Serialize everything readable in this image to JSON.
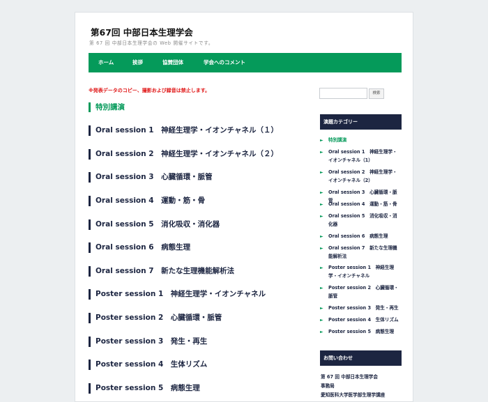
{
  "site": {
    "title": "第67回 中部日本生理学会",
    "description": "第 67 回 中部日本生理学会の Web 開催サイトです。"
  },
  "nav": [
    {
      "label": "ホーム"
    },
    {
      "label": "挨拶"
    },
    {
      "label": "協賛団体"
    },
    {
      "label": "学会へのコメント"
    }
  ],
  "main": {
    "warning": "※発表データのコピー、撮影および録音は禁止します。",
    "section_title": "特別講演",
    "sessions": [
      "Oral session 1　神経生理学・イオンチャネル（１）",
      "Oral session 2　神経生理学・イオンチャネル（２）",
      "Oral session 3　心臓循環・脈管",
      "Oral session 4　運動・筋・骨",
      "Oral session 5　消化吸収・消化器",
      "Oral session 6　病態生理",
      "Oral session 7　新たな生理機能解析法",
      "Poster session 1　神経生理学・イオンチャネル",
      "Poster session 2　心臓循環・脈管",
      "Poster session 3　発生・再生",
      "Poster session 4　生体リズム",
      "Poster session 5　病態生理"
    ]
  },
  "sidebar": {
    "search_button": "検索",
    "category_title": "演題カテゴリー",
    "categories": [
      "特別講演",
      "Oral session 1　神経生理学・イオンチャネル（1）",
      "Oral session 2　神経生理学・イオンチャネル（2）",
      "Oral session 3　心臓循環・脈管",
      "Oral session 4　運動・筋・骨",
      "Oral session 5　消化吸収・消化器",
      "Oral session 6　病態生理",
      "Oral session 7　新たな生理機能解析法",
      "Poster session 1　神経生理学・イオンチャネル",
      "Poster session 2　心臓循環・脈管",
      "Poster session 3　発生・再生",
      "Poster session 4　生体リズム",
      "Poster session 5　病態生理"
    ],
    "contact_title": "お問い合わせ",
    "contact_lines": [
      "第 67 回 中部日本生理学会",
      "事務局",
      "愛知医科大学医学部生理学講座"
    ]
  },
  "colors": {
    "accent": "#059a5a",
    "navy": "#1c2541",
    "warning": "#e01515"
  }
}
